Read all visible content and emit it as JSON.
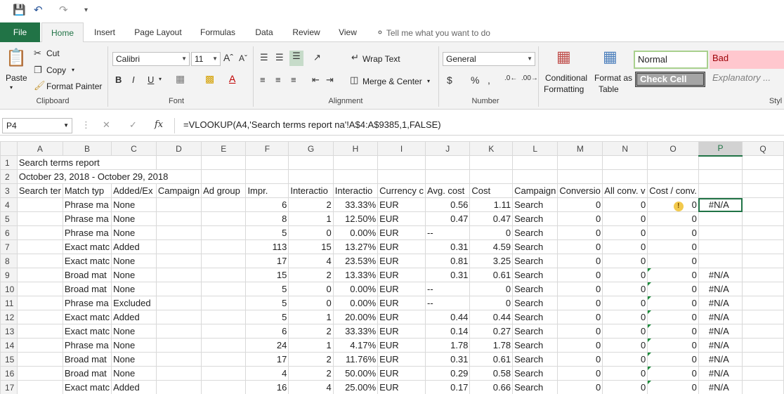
{
  "qat": {
    "save_icon": "save-icon",
    "undo_icon": "undo-icon",
    "redo_icon": "redo-icon"
  },
  "tabs": [
    "File",
    "Home",
    "Insert",
    "Page Layout",
    "Formulas",
    "Data",
    "Review",
    "View"
  ],
  "tell_me": "Tell me what you want to do",
  "clipboard": {
    "paste": "Paste",
    "cut": "Cut",
    "copy": "Copy",
    "format_painter": "Format Painter",
    "label": "Clipboard"
  },
  "font": {
    "name": "Calibri",
    "size": "11",
    "label": "Font",
    "bold": "B",
    "italic": "I",
    "underline": "U"
  },
  "alignment": {
    "wrap": "Wrap Text",
    "merge": "Merge & Center",
    "label": "Alignment"
  },
  "number": {
    "format": "General",
    "currency": "$",
    "percent": "%",
    "comma": ",",
    "label": "Number"
  },
  "styles": {
    "conditional": "Conditional",
    "conditional2": "Formatting",
    "format_as": "Format as",
    "table": "Table",
    "normal": "Normal",
    "bad": "Bad",
    "check": "Check Cell",
    "explanatory": "Explanatory ...",
    "label": "Styl"
  },
  "formula_bar": {
    "name_box": "P4",
    "formula": "=VLOOKUP(A4,'Search terms report na'!A$4:A$9385,1,FALSE)",
    "fx": "fx"
  },
  "columns": [
    "A",
    "B",
    "C",
    "D",
    "E",
    "F",
    "G",
    "H",
    "I",
    "J",
    "K",
    "L",
    "M",
    "N",
    "O",
    "P",
    "Q"
  ],
  "row1": "Search terms report",
  "row2": "October 23, 2018 - October 29, 2018",
  "headers": [
    "Search ter",
    "Match typ",
    "Added/Ex",
    "Campaign",
    "Ad group",
    "Impr.",
    "Interactio",
    "Interactio",
    "Currency c",
    "Avg. cost",
    "Cost",
    "Campaign",
    "Conversio",
    "All conv. v",
    "Cost / conv.",
    "",
    ""
  ],
  "rows": [
    {
      "n": "4",
      "b": "Phrase ma",
      "c": "None",
      "f": "6",
      "g": "2",
      "h": "33.33%",
      "i": "EUR",
      "j": "0.56",
      "k": "1.11",
      "l": "Search",
      "m": "0",
      "nn": "0",
      "o": "0",
      "p": "#N/A"
    },
    {
      "n": "5",
      "b": "Phrase ma",
      "c": "None",
      "f": "8",
      "g": "1",
      "h": "12.50%",
      "i": "EUR",
      "j": "0.47",
      "k": "0.47",
      "l": "Search",
      "m": "0",
      "nn": "0",
      "o": "0",
      "p": ""
    },
    {
      "n": "6",
      "b": "Phrase ma",
      "c": "None",
      "f": "5",
      "g": "0",
      "h": "0.00%",
      "i": "EUR",
      "j": "--",
      "k": "0",
      "l": "Search",
      "m": "0",
      "nn": "0",
      "o": "0",
      "p": ""
    },
    {
      "n": "7",
      "b": "Exact matc",
      "c": "Added",
      "f": "113",
      "g": "15",
      "h": "13.27%",
      "i": "EUR",
      "j": "0.31",
      "k": "4.59",
      "l": "Search",
      "m": "0",
      "nn": "0",
      "o": "0",
      "p": ""
    },
    {
      "n": "8",
      "b": "Exact matc",
      "c": "None",
      "f": "17",
      "g": "4",
      "h": "23.53%",
      "i": "EUR",
      "j": "0.81",
      "k": "3.25",
      "l": "Search",
      "m": "0",
      "nn": "0",
      "o": "0",
      "p": ""
    },
    {
      "n": "9",
      "b": "Broad mat",
      "c": "None",
      "f": "15",
      "g": "2",
      "h": "13.33%",
      "i": "EUR",
      "j": "0.31",
      "k": "0.61",
      "l": "Search",
      "m": "0",
      "nn": "0",
      "o": "0",
      "p": "#N/A"
    },
    {
      "n": "10",
      "b": "Broad mat",
      "c": "None",
      "f": "5",
      "g": "0",
      "h": "0.00%",
      "i": "EUR",
      "j": "--",
      "k": "0",
      "l": "Search",
      "m": "0",
      "nn": "0",
      "o": "0",
      "p": "#N/A"
    },
    {
      "n": "11",
      "b": "Phrase ma",
      "c": "Excluded",
      "f": "5",
      "g": "0",
      "h": "0.00%",
      "i": "EUR",
      "j": "--",
      "k": "0",
      "l": "Search",
      "m": "0",
      "nn": "0",
      "o": "0",
      "p": "#N/A"
    },
    {
      "n": "12",
      "b": "Exact matc",
      "c": "Added",
      "f": "5",
      "g": "1",
      "h": "20.00%",
      "i": "EUR",
      "j": "0.44",
      "k": "0.44",
      "l": "Search",
      "m": "0",
      "nn": "0",
      "o": "0",
      "p": "#N/A"
    },
    {
      "n": "13",
      "b": "Exact matc",
      "c": "None",
      "f": "6",
      "g": "2",
      "h": "33.33%",
      "i": "EUR",
      "j": "0.14",
      "k": "0.27",
      "l": "Search",
      "m": "0",
      "nn": "0",
      "o": "0",
      "p": "#N/A"
    },
    {
      "n": "14",
      "b": "Phrase ma",
      "c": "None",
      "f": "24",
      "g": "1",
      "h": "4.17%",
      "i": "EUR",
      "j": "1.78",
      "k": "1.78",
      "l": "Search",
      "m": "0",
      "nn": "0",
      "o": "0",
      "p": "#N/A"
    },
    {
      "n": "15",
      "b": "Broad mat",
      "c": "None",
      "f": "17",
      "g": "2",
      "h": "11.76%",
      "i": "EUR",
      "j": "0.31",
      "k": "0.61",
      "l": "Search",
      "m": "0",
      "nn": "0",
      "o": "0",
      "p": "#N/A"
    },
    {
      "n": "16",
      "b": "Broad mat",
      "c": "None",
      "f": "4",
      "g": "2",
      "h": "50.00%",
      "i": "EUR",
      "j": "0.29",
      "k": "0.58",
      "l": "Search",
      "m": "0",
      "nn": "0",
      "o": "0",
      "p": "#N/A"
    },
    {
      "n": "17",
      "b": "Exact matc",
      "c": "Added",
      "f": "16",
      "g": "4",
      "h": "25.00%",
      "i": "EUR",
      "j": "0.17",
      "k": "0.66",
      "l": "Search",
      "m": "0",
      "nn": "0",
      "o": "0",
      "p": "#N/A"
    }
  ]
}
